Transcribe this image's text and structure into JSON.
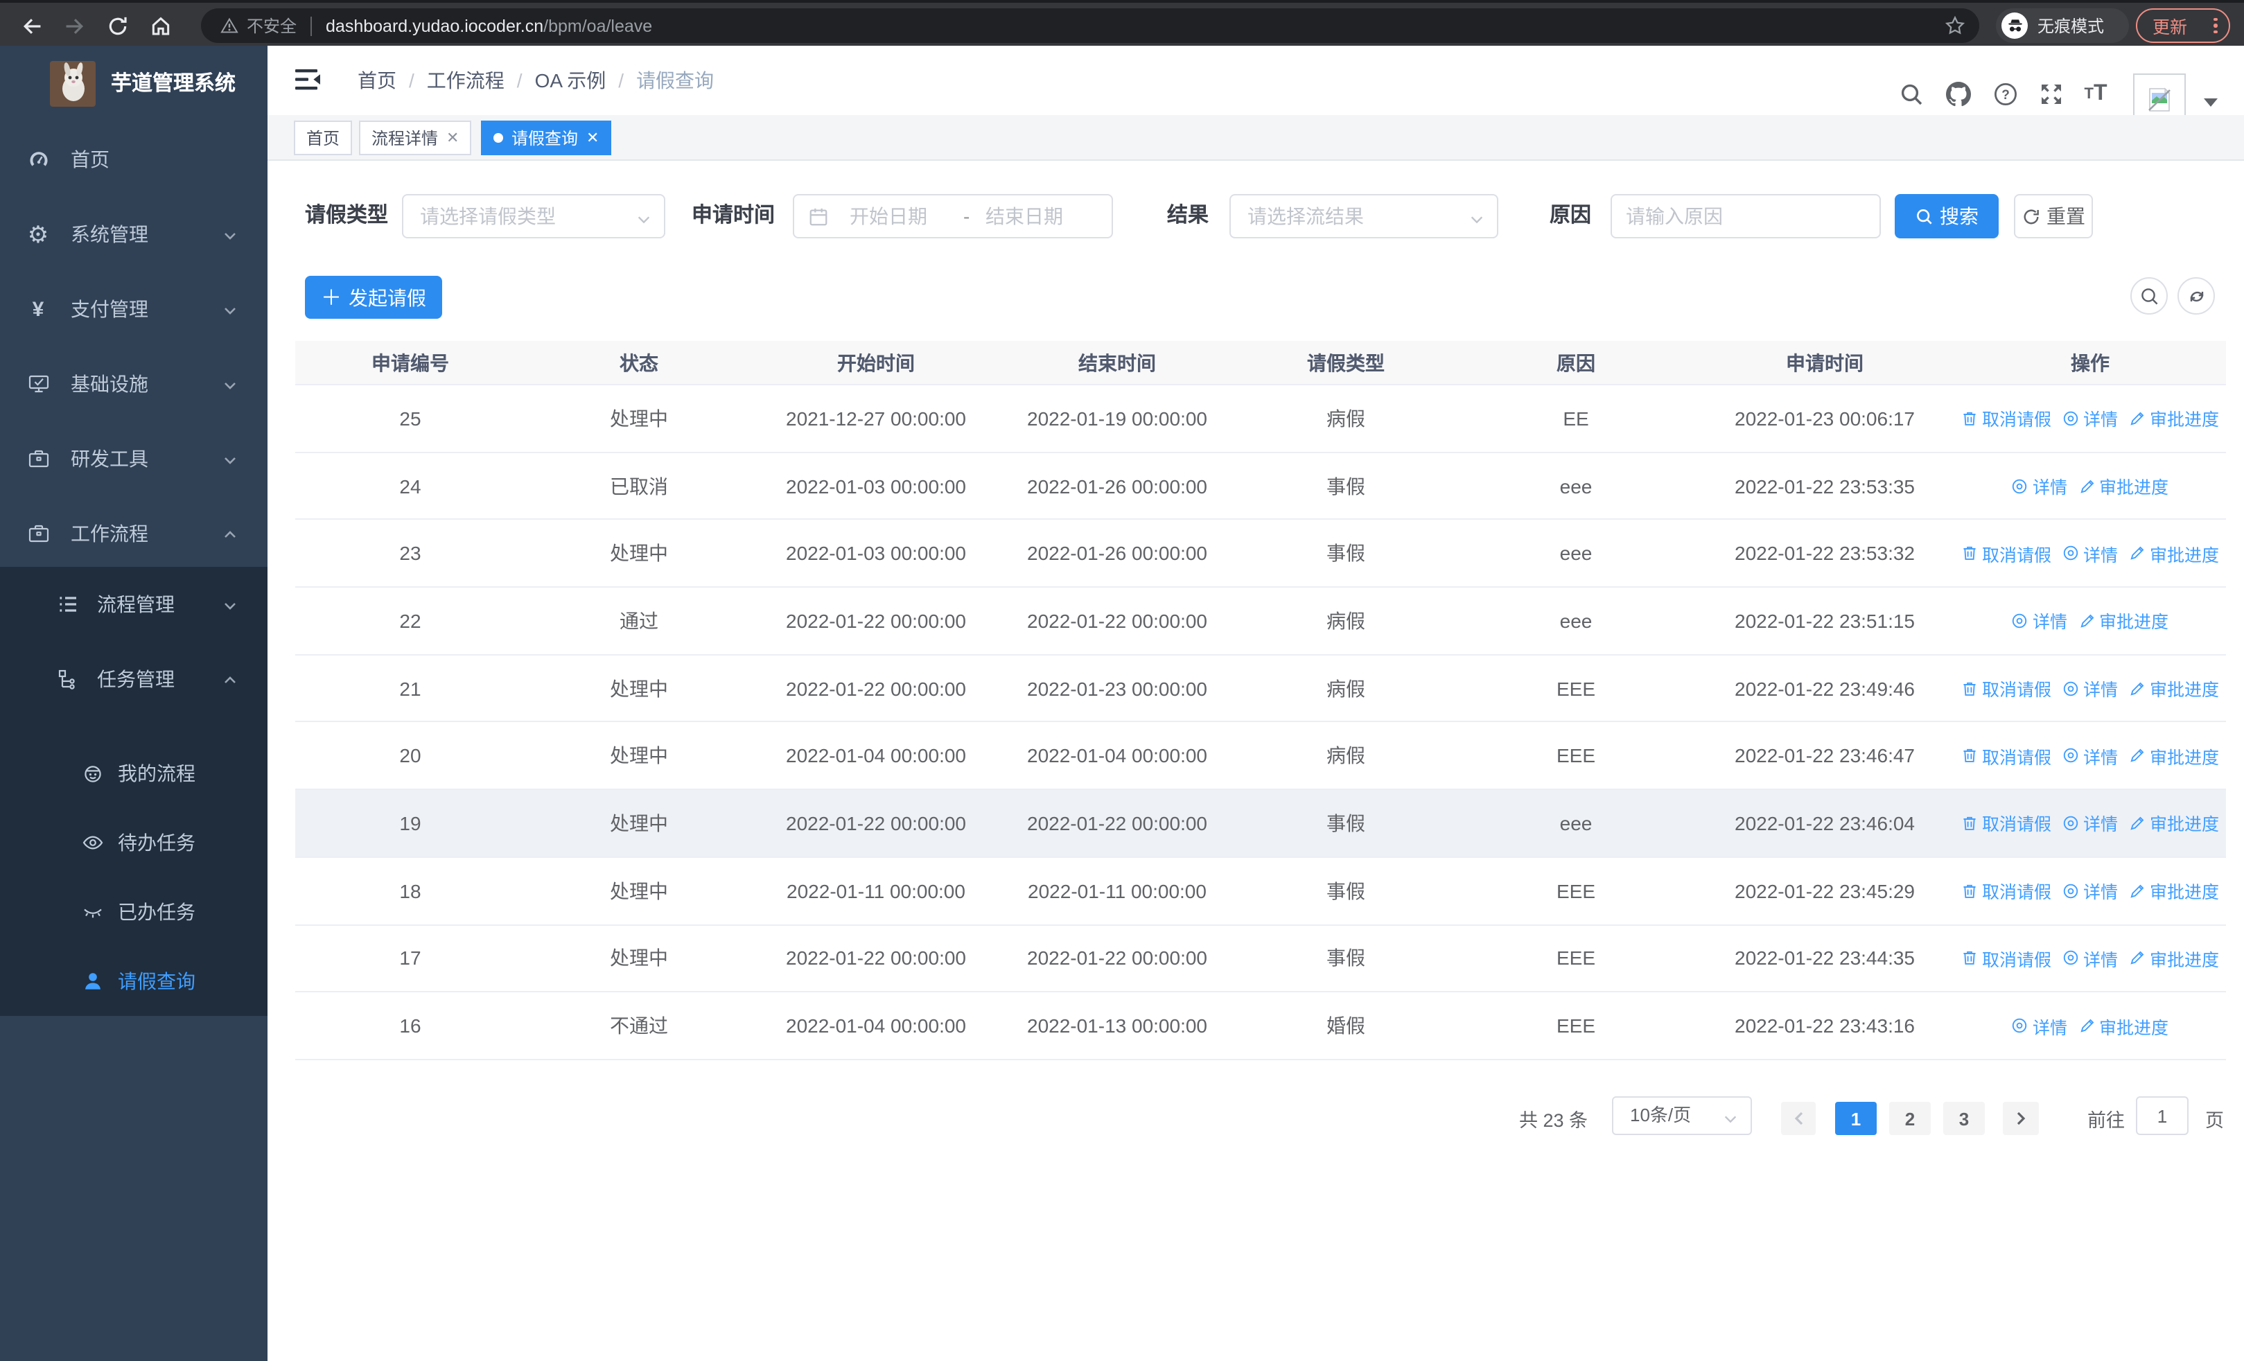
{
  "browser": {
    "security": "不安全",
    "host": "dashboard.yudao.iocoder.cn",
    "path": "/bpm/oa/leave",
    "incognito": "无痕模式",
    "update": "更新"
  },
  "sidebar": {
    "title": "芋道管理系统",
    "items": [
      {
        "label": "首页"
      },
      {
        "label": "系统管理"
      },
      {
        "label": "支付管理"
      },
      {
        "label": "基础设施"
      },
      {
        "label": "研发工具"
      },
      {
        "label": "工作流程"
      },
      {
        "label": "流程管理"
      },
      {
        "label": "任务管理"
      },
      {
        "label": "我的流程"
      },
      {
        "label": "待办任务"
      },
      {
        "label": "已办任务"
      },
      {
        "label": "请假查询"
      }
    ]
  },
  "header": {
    "breadcrumb": [
      "首页",
      "工作流程",
      "OA 示例",
      "请假查询"
    ]
  },
  "tabs": [
    {
      "label": "首页"
    },
    {
      "label": "流程详情"
    },
    {
      "label": "请假查询"
    }
  ],
  "filters": {
    "leave_type_label": "请假类型",
    "leave_type_placeholder": "请选择请假类型",
    "apply_time_label": "申请时间",
    "start_date_placeholder": "开始日期",
    "range_separator": "-",
    "end_date_placeholder": "结束日期",
    "result_label": "结果",
    "result_placeholder": "请选择流结果",
    "reason_label": "原因",
    "reason_placeholder": "请输入原因",
    "search_label": "搜索",
    "reset_label": "重置"
  },
  "toolbar": {
    "create_label": "发起请假"
  },
  "table": {
    "columns": [
      "申请编号",
      "状态",
      "开始时间",
      "结束时间",
      "请假类型",
      "原因",
      "申请时间",
      "操作"
    ],
    "action_labels": {
      "cancel": "取消请假",
      "detail": "详情",
      "progress": "审批进度"
    },
    "rows": [
      {
        "id": "25",
        "status": "处理中",
        "start": "2021-12-27 00:00:00",
        "end": "2022-01-19 00:00:00",
        "type": "病假",
        "reason": "EE",
        "applied": "2022-01-23 00:06:17",
        "actions": [
          "cancel",
          "detail",
          "progress"
        ],
        "highlighted": false
      },
      {
        "id": "24",
        "status": "已取消",
        "start": "2022-01-03 00:00:00",
        "end": "2022-01-26 00:00:00",
        "type": "事假",
        "reason": "eee",
        "applied": "2022-01-22 23:53:35",
        "actions": [
          "detail",
          "progress"
        ],
        "highlighted": false
      },
      {
        "id": "23",
        "status": "处理中",
        "start": "2022-01-03 00:00:00",
        "end": "2022-01-26 00:00:00",
        "type": "事假",
        "reason": "eee",
        "applied": "2022-01-22 23:53:32",
        "actions": [
          "cancel",
          "detail",
          "progress"
        ],
        "highlighted": false
      },
      {
        "id": "22",
        "status": "通过",
        "start": "2022-01-22 00:00:00",
        "end": "2022-01-22 00:00:00",
        "type": "病假",
        "reason": "eee",
        "applied": "2022-01-22 23:51:15",
        "actions": [
          "detail",
          "progress"
        ],
        "highlighted": false
      },
      {
        "id": "21",
        "status": "处理中",
        "start": "2022-01-22 00:00:00",
        "end": "2022-01-23 00:00:00",
        "type": "病假",
        "reason": "EEE",
        "applied": "2022-01-22 23:49:46",
        "actions": [
          "cancel",
          "detail",
          "progress"
        ],
        "highlighted": false
      },
      {
        "id": "20",
        "status": "处理中",
        "start": "2022-01-04 00:00:00",
        "end": "2022-01-04 00:00:00",
        "type": "病假",
        "reason": "EEE",
        "applied": "2022-01-22 23:46:47",
        "actions": [
          "cancel",
          "detail",
          "progress"
        ],
        "highlighted": false
      },
      {
        "id": "19",
        "status": "处理中",
        "start": "2022-01-22 00:00:00",
        "end": "2022-01-22 00:00:00",
        "type": "事假",
        "reason": "eee",
        "applied": "2022-01-22 23:46:04",
        "actions": [
          "cancel",
          "detail",
          "progress"
        ],
        "highlighted": true
      },
      {
        "id": "18",
        "status": "处理中",
        "start": "2022-01-11 00:00:00",
        "end": "2022-01-11 00:00:00",
        "type": "事假",
        "reason": "EEE",
        "applied": "2022-01-22 23:45:29",
        "actions": [
          "cancel",
          "detail",
          "progress"
        ],
        "highlighted": false
      },
      {
        "id": "17",
        "status": "处理中",
        "start": "2022-01-22 00:00:00",
        "end": "2022-01-22 00:00:00",
        "type": "事假",
        "reason": "EEE",
        "applied": "2022-01-22 23:44:35",
        "actions": [
          "cancel",
          "detail",
          "progress"
        ],
        "highlighted": false
      },
      {
        "id": "16",
        "status": "不通过",
        "start": "2022-01-04 00:00:00",
        "end": "2022-01-13 00:00:00",
        "type": "婚假",
        "reason": "EEE",
        "applied": "2022-01-22 23:43:16",
        "actions": [
          "detail",
          "progress"
        ],
        "highlighted": false
      }
    ]
  },
  "pagination": {
    "total": "共 23 条",
    "page_size": "10条/页",
    "pages": [
      "1",
      "2",
      "3"
    ],
    "active_page": "1",
    "goto_label": "前往",
    "goto_value": "1",
    "page_unit": "页"
  },
  "colors": {
    "primary": "#2d8cf0",
    "link": "#409eff",
    "sidebar_bg": "#304156",
    "submenu_bg": "#1f2d3d",
    "update_accent": "#ee8e84",
    "row_highlight": "#eef1f6"
  }
}
